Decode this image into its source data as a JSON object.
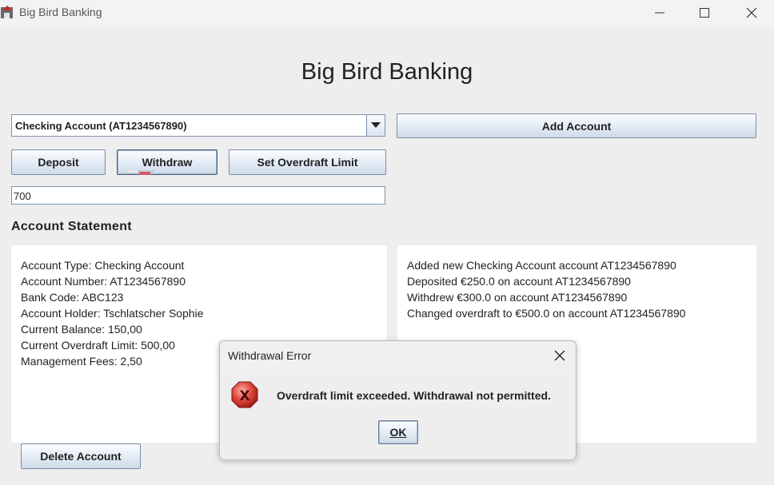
{
  "window": {
    "title": "Big Bird Banking"
  },
  "header": {
    "title": "Big Bird Banking"
  },
  "controls": {
    "account_selected": "Checking Account (AT1234567890)",
    "add_account": "Add Account",
    "deposit": "Deposit",
    "withdraw": "Withdraw",
    "set_overdraft": "Set Overdraft Limit",
    "amount_value": "700"
  },
  "statement": {
    "title": "Account Statement",
    "details": [
      "Account Type: Checking Account",
      "Account Number: AT1234567890",
      "Bank Code: ABC123",
      "Account Holder: Tschlatscher Sophie",
      "Current Balance: 150,00",
      "Current Overdraft Limit: 500,00",
      "Management Fees: 2,50"
    ],
    "log": [
      "Added new Checking Account account AT1234567890",
      "Deposited €250.0 on account AT1234567890",
      "Withdrew €300.0 on account AT1234567890",
      "Changed overdraft to €500.0 on account AT1234567890"
    ]
  },
  "footer": {
    "delete_account": "Delete Account"
  },
  "dialog": {
    "title": "Withdrawal Error",
    "message": "Overdraft limit exceeded. Withdrawal not permitted.",
    "ok": "OK",
    "icon": "error-icon"
  },
  "colors": {
    "button_border": "#7a8ea6",
    "error_red": "#d9362f"
  }
}
